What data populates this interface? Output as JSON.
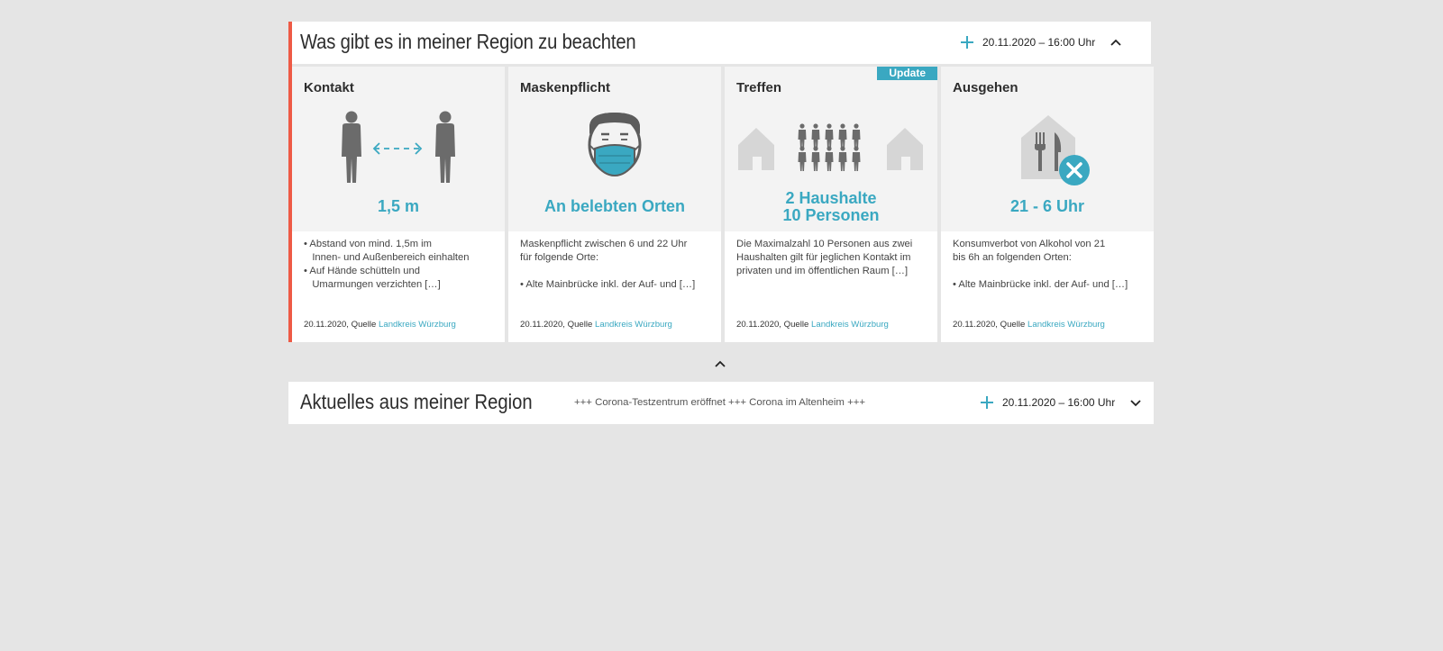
{
  "region_panel": {
    "title": "Was gibt es in meiner Region zu beachten",
    "date": "20.11.2020 – 16:00 Uhr",
    "add_icon": "plus-icon",
    "toggle_icon": "chevron-up-icon",
    "accent_color": "#ee5a45",
    "highlight_color": "#3aa8c1"
  },
  "cards": [
    {
      "title": "Kontakt",
      "icon": "distance-people-icon",
      "headline": "1,5 m",
      "body": [
        "• Abstand von mind. 1,5m im",
        "   Innen- und Außenbereich einhalten",
        "• Auf Hände schütteln und",
        "   Umarmungen verzichten […]"
      ],
      "source_prefix": "20.11.2020, Quelle",
      "source_link": "Landkreis Würzburg"
    },
    {
      "title": "Maskenpflicht",
      "icon": "face-mask-icon",
      "headline": "An belebten Orten",
      "body": [
        "Maskenpflicht zwischen 6 und 22 Uhr",
        "für folgende Orte:",
        "",
        "• Alte Mainbrücke inkl. der Auf- und […]"
      ],
      "source_prefix": "20.11.2020, Quelle",
      "source_link": "Landkreis Würzburg"
    },
    {
      "title": "Treffen",
      "icon": "households-meeting-icon",
      "badge": "Update",
      "headline_line1": "2 Haushalte",
      "headline_line2": "10 Personen",
      "body": [
        "Die Maximalzahl 10 Personen aus zwei",
        "Haushalten gilt für jeglichen Kontakt im",
        "privaten und im öffentlichen Raum […]"
      ],
      "source_prefix": "20.11.2020, Quelle",
      "source_link": "Landkreis Würzburg"
    },
    {
      "title": "Ausgehen",
      "icon": "restaurant-closed-icon",
      "headline": "21 - 6 Uhr",
      "body": [
        "Konsumverbot von Alkohol von 21",
        "bis 6h an folgenden Orten:",
        "",
        "• Alte Mainbrücke inkl. der Auf- und […]"
      ],
      "source_prefix": "20.11.2020, Quelle",
      "source_link": "Landkreis Würzburg"
    }
  ],
  "collapse_icon": "chevron-up-icon",
  "news_bar": {
    "title": "Aktuelles aus meiner Region",
    "ticker": "+++ Corona-Testzentrum eröffnet +++ Corona im Altenheim +++",
    "date": "20.11.2020 – 16:00 Uhr",
    "add_icon": "plus-icon",
    "toggle_icon": "chevron-down-icon"
  }
}
